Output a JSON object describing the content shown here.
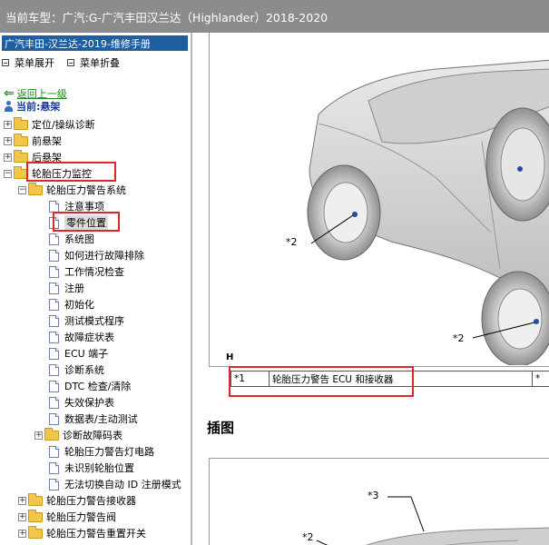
{
  "titlebar": {
    "label": "当前车型：",
    "vehicle": "广汽:G-广汽丰田汉兰达（Highlander）2018-2020"
  },
  "sidebar": {
    "manual_title": "广汽丰田-汉兰达-2019-维修手册",
    "expand_label": "菜单展开",
    "collapse_label": "菜单折叠",
    "back_label": "返回上一级",
    "current_label": "当前:悬架",
    "tree": [
      {
        "label": "定位/操纵诊断",
        "type": "folder",
        "expander": "+"
      },
      {
        "label": "前悬架",
        "type": "folder",
        "expander": "+"
      },
      {
        "label": "后悬架",
        "type": "folder",
        "expander": "+"
      },
      {
        "label": "轮胎压力监控",
        "type": "folder",
        "expander": "−"
      },
      {
        "label": "轮胎压力警告系统",
        "type": "folder",
        "expander": "−"
      },
      {
        "label": "注意事项",
        "type": "doc"
      },
      {
        "label": "零件位置",
        "type": "doc",
        "selected": true
      },
      {
        "label": "系统图",
        "type": "doc"
      },
      {
        "label": "如何进行故障排除",
        "type": "doc"
      },
      {
        "label": "工作情况检查",
        "type": "doc"
      },
      {
        "label": "注册",
        "type": "doc"
      },
      {
        "label": "初始化",
        "type": "doc"
      },
      {
        "label": "测试模式程序",
        "type": "doc"
      },
      {
        "label": "故障症状表",
        "type": "doc"
      },
      {
        "label": "ECU 端子",
        "type": "doc"
      },
      {
        "label": "诊断系统",
        "type": "doc"
      },
      {
        "label": "DTC 检查/清除",
        "type": "doc"
      },
      {
        "label": "失效保护表",
        "type": "doc"
      },
      {
        "label": "数据表/主动测试",
        "type": "doc"
      },
      {
        "label": "诊断故障码表",
        "type": "folder",
        "expander": "+"
      },
      {
        "label": "轮胎压力警告灯电路",
        "type": "doc"
      },
      {
        "label": "未识别轮胎位置",
        "type": "doc"
      },
      {
        "label": "无法切换自动 ID 注册模式",
        "type": "doc"
      },
      {
        "label": "轮胎压力警告接收器",
        "type": "folder",
        "expander": "+"
      },
      {
        "label": "轮胎压力警告阀",
        "type": "folder",
        "expander": "+"
      },
      {
        "label": "轮胎压力警告重置开关",
        "type": "folder",
        "expander": "+"
      }
    ]
  },
  "content": {
    "figure1": {
      "letter": "H",
      "callouts": [
        "*2",
        "*2"
      ]
    },
    "legend": [
      {
        "id": "*1",
        "desc": "轮胎压力警告 ECU 和接收器",
        "extra": "*"
      }
    ],
    "section_title": "插图",
    "figure2": {
      "callouts": [
        "*3",
        "*2"
      ]
    }
  }
}
